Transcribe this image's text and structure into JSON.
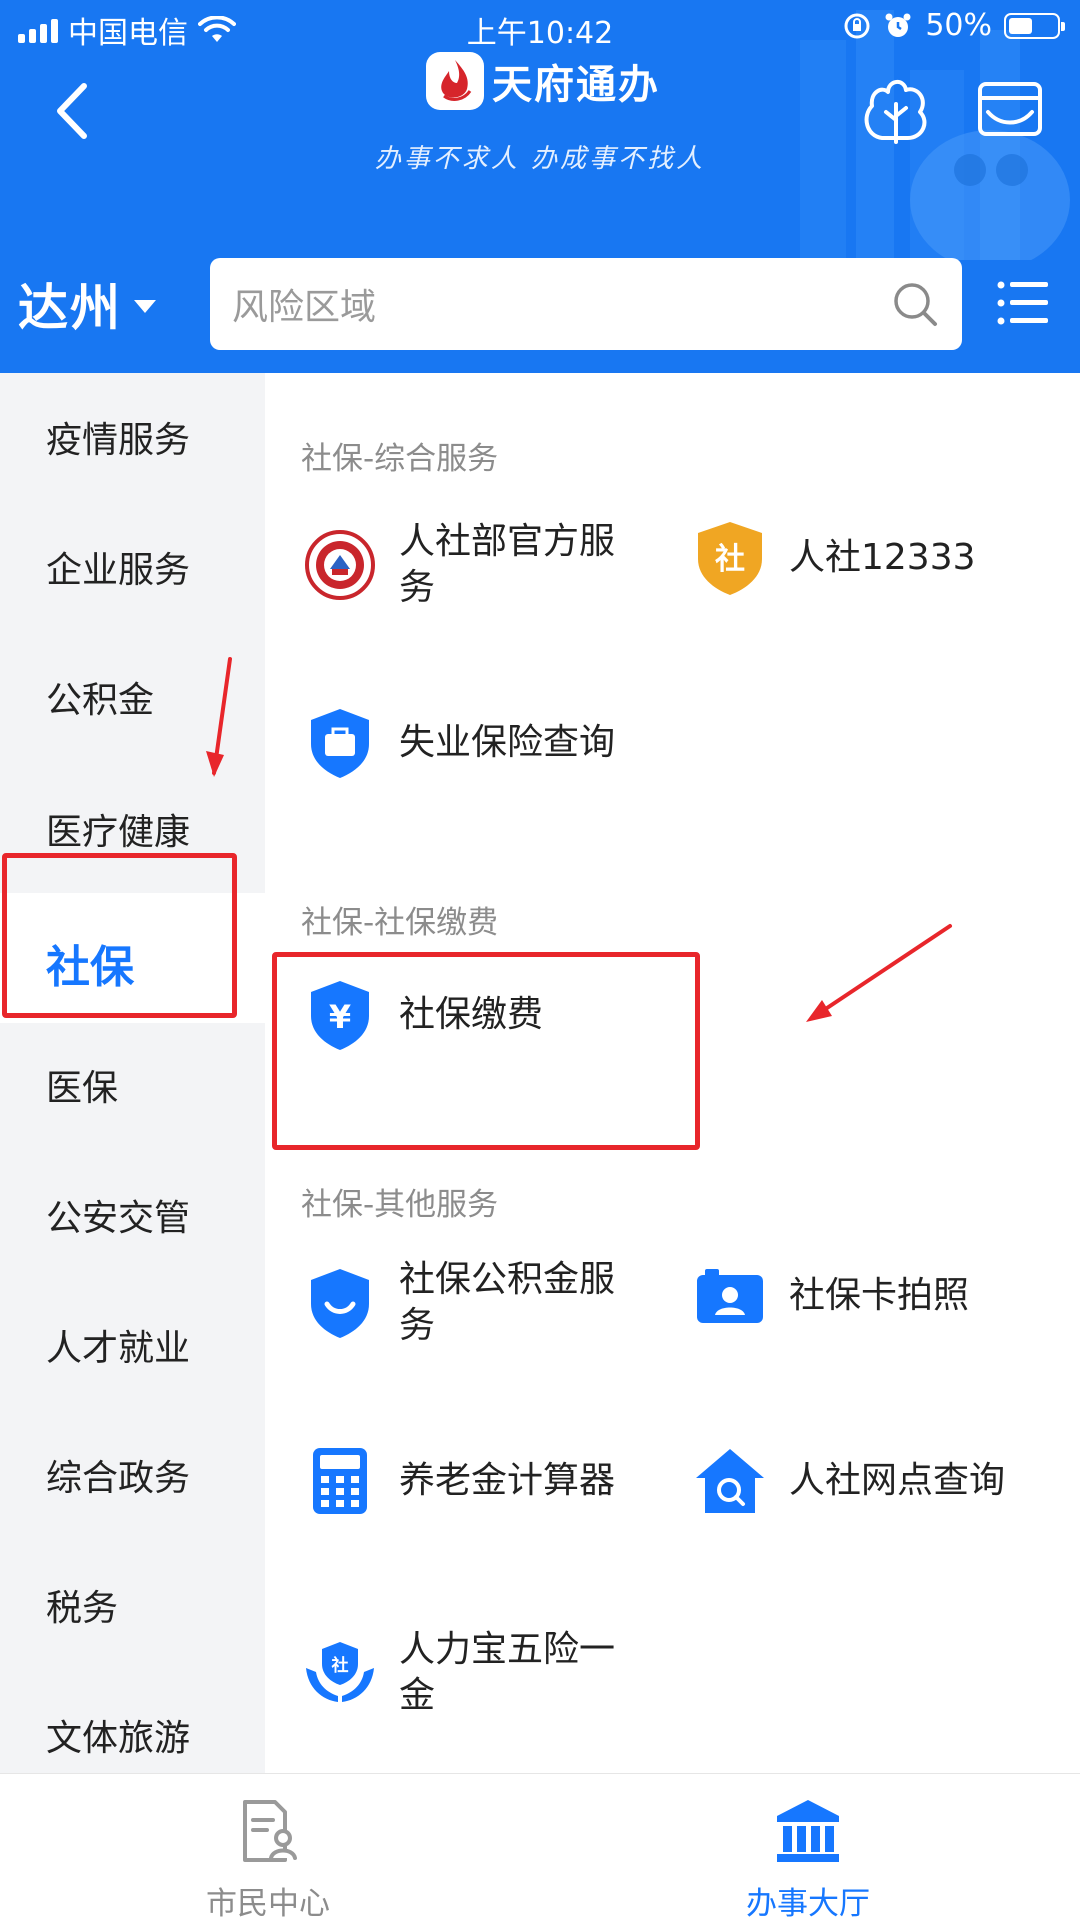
{
  "status_bar": {
    "carrier": "中国电信",
    "time": "上午10:42",
    "battery": "50%",
    "battery_level": 0.5
  },
  "header": {
    "app_name": "天府通办",
    "slogan": "办事不求人 办成事不找人",
    "city": "达州",
    "search_placeholder": "风险区域"
  },
  "sidebar": {
    "items": [
      {
        "label": "疫情服务"
      },
      {
        "label": "企业服务"
      },
      {
        "label": "公积金"
      },
      {
        "label": "医疗健康"
      },
      {
        "label": "社保",
        "active": true
      },
      {
        "label": "医保"
      },
      {
        "label": "公安交管"
      },
      {
        "label": "人才就业"
      },
      {
        "label": "综合政务"
      },
      {
        "label": "税务"
      },
      {
        "label": "文体旅游"
      }
    ]
  },
  "content": {
    "sections": [
      {
        "title": "社保-综合服务",
        "items": [
          {
            "label": "人社部官方服务",
            "icon": "social-security-emblem-icon"
          },
          {
            "label": "人社12333",
            "icon": "shield-she-badge-icon"
          },
          {
            "label": "失业保险查询",
            "icon": "briefcase-shield-icon"
          }
        ]
      },
      {
        "title": "社保-社保缴费",
        "items": [
          {
            "label": "社保缴费",
            "icon": "yuan-shield-icon"
          }
        ]
      },
      {
        "title": "社保-其他服务",
        "items": [
          {
            "label": "社保公积金服务",
            "icon": "smile-shield-icon"
          },
          {
            "label": "社保卡拍照",
            "icon": "id-photo-icon"
          },
          {
            "label": "养老金计算器",
            "icon": "calculator-icon"
          },
          {
            "label": "人社网点查询",
            "icon": "house-search-icon"
          },
          {
            "label": "人力宝五险一金",
            "icon": "hands-shield-icon"
          }
        ]
      }
    ]
  },
  "tabbar": {
    "tabs": [
      {
        "label": "市民中心",
        "active": false
      },
      {
        "label": "办事大厅",
        "active": true
      }
    ]
  },
  "colors": {
    "brand": "#1877f2",
    "active_text": "#1677ff",
    "icon_blue": "#1677ff",
    "badge_orange": "#f0a623",
    "annotation_red": "#e8262b"
  }
}
